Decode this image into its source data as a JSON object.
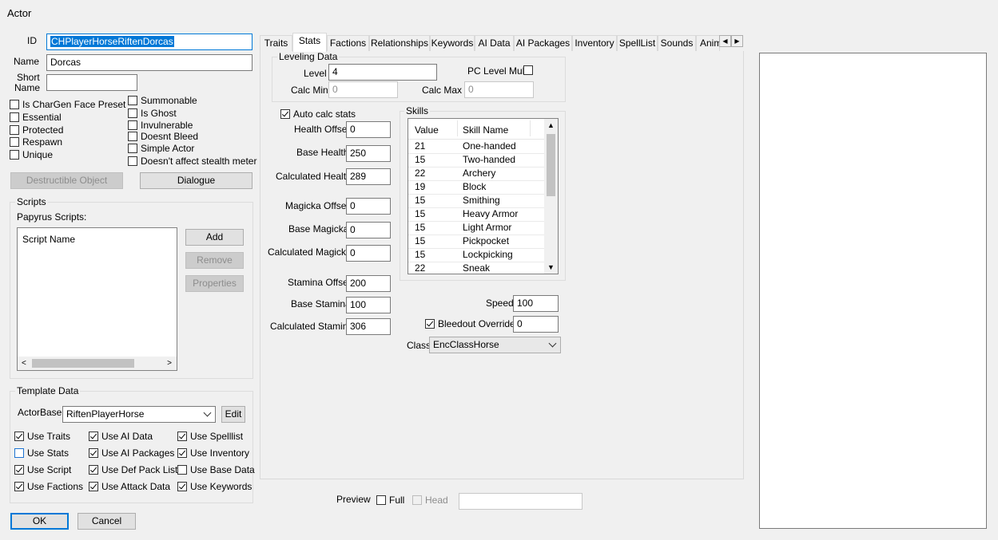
{
  "window": {
    "title": "Actor"
  },
  "left": {
    "id_label": "ID",
    "id_value": "CHPlayerHorseRiftenDorcas",
    "name_label": "Name",
    "name_value": "Dorcas",
    "short_name_label_1": "Short",
    "short_name_label_2": "Name",
    "short_name_value": "",
    "flags_left": [
      {
        "label": "Is CharGen Face Preset",
        "checked": false
      },
      {
        "label": "Essential",
        "checked": false
      },
      {
        "label": "Protected",
        "checked": false
      },
      {
        "label": "Respawn",
        "checked": false
      },
      {
        "label": "Unique",
        "checked": false
      }
    ],
    "flags_right": [
      {
        "label": "Summonable",
        "checked": false
      },
      {
        "label": "Is Ghost",
        "checked": false
      },
      {
        "label": "Invulnerable",
        "checked": false
      },
      {
        "label": "Doesnt Bleed",
        "checked": false
      },
      {
        "label": "Simple Actor",
        "checked": false
      },
      {
        "label": "Doesn't affect stealth meter",
        "checked": false
      }
    ],
    "destructible_button": "Destructible Object",
    "dialogue_button": "Dialogue"
  },
  "scripts": {
    "group_title": "Scripts",
    "papyrus_label": "Papyrus Scripts:",
    "column_header": "Script Name",
    "add": "Add",
    "remove": "Remove",
    "properties": "Properties"
  },
  "template": {
    "group_title": "Template Data",
    "actorbase_label": "ActorBase",
    "actorbase_value": "RiftenPlayerHorse",
    "edit": "Edit",
    "col1": [
      {
        "label": "Use Traits",
        "checked": true
      },
      {
        "label": "Use Stats",
        "checked": false
      },
      {
        "label": "Use Script",
        "checked": true
      },
      {
        "label": "Use Factions",
        "checked": true
      }
    ],
    "col2": [
      {
        "label": "Use AI Data",
        "checked": true
      },
      {
        "label": "Use AI Packages",
        "checked": true
      },
      {
        "label": "Use Def Pack List",
        "checked": true
      },
      {
        "label": "Use Attack Data",
        "checked": true
      }
    ],
    "col3": [
      {
        "label": "Use Spelllist",
        "checked": true
      },
      {
        "label": "Use Inventory",
        "checked": true
      },
      {
        "label": "Use Base Data",
        "checked": false
      },
      {
        "label": "Use Keywords",
        "checked": true
      }
    ]
  },
  "bottom": {
    "ok": "OK",
    "cancel": "Cancel"
  },
  "tabs": [
    "Traits",
    "Stats",
    "Factions",
    "Relationships",
    "Keywords",
    "AI Data",
    "AI Packages",
    "Inventory",
    "SpellList",
    "Sounds",
    "Anim"
  ],
  "active_tab": "Stats",
  "stats": {
    "leveling_title": "Leveling Data",
    "level_label": "Level",
    "level_value": "4",
    "pc_level_mult_label": "PC Level Mult",
    "calc_min_label": "Calc Min",
    "calc_min_value": "0",
    "calc_max_label": "Calc Max",
    "calc_max_value": "0",
    "auto_calc_label": "Auto calc stats",
    "health_offset_label": "Health Offset",
    "health_offset": "0",
    "base_health_label": "Base Health",
    "base_health": "250",
    "calculated_health_label": "Calculated Health",
    "calculated_health": "289",
    "magicka_offset_label": "Magicka Offset",
    "magicka_offset": "0",
    "base_magicka_label": "Base Magicka",
    "base_magicka": "0",
    "calculated_magicka_label": "Calculated Magicka",
    "calculated_magicka": "0",
    "stamina_offset_label": "Stamina Offset",
    "stamina_offset": "200",
    "base_stamina_label": "Base Stamina",
    "base_stamina": "100",
    "calculated_stamina_label": "Calculated Stamina",
    "calculated_stamina": "306",
    "skills_title": "Skills",
    "skills_col_value": "Value",
    "skills_col_name": "Skill Name",
    "skills": [
      {
        "value": "21",
        "name": "One-handed"
      },
      {
        "value": "15",
        "name": "Two-handed"
      },
      {
        "value": "22",
        "name": "Archery"
      },
      {
        "value": "19",
        "name": "Block"
      },
      {
        "value": "15",
        "name": "Smithing"
      },
      {
        "value": "15",
        "name": "Heavy Armor"
      },
      {
        "value": "15",
        "name": "Light Armor"
      },
      {
        "value": "15",
        "name": "Pickpocket"
      },
      {
        "value": "15",
        "name": "Lockpicking"
      },
      {
        "value": "22",
        "name": "Sneak"
      }
    ],
    "speed_label": "Speed",
    "speed_value": "100",
    "bleedout_label": "Bleedout Override",
    "bleedout_value": "0",
    "class_label": "Class",
    "class_value": "EncClassHorse"
  },
  "preview": {
    "label": "Preview",
    "full": "Full",
    "head": "Head",
    "value": ""
  }
}
